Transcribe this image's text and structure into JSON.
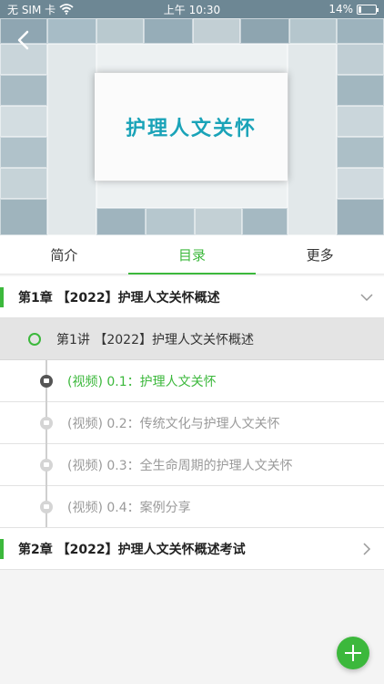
{
  "status_bar": {
    "carrier": "无 SIM 卡",
    "time": "上午 10:30",
    "battery": "14%",
    "battery_level": 0.14
  },
  "banner": {
    "title": "护理人文关怀"
  },
  "tabs": [
    {
      "label": "简介"
    },
    {
      "label": "目录"
    },
    {
      "label": "更多"
    }
  ],
  "chapters": [
    {
      "label": "第1章 【2022】护理人文关怀概述"
    },
    {
      "label": "第2章 【2022】护理人文关怀概述考试"
    }
  ],
  "lecture": {
    "label": "第1讲 【2022】护理人文关怀概述"
  },
  "items": [
    {
      "label": "(视频) 0.1：护理人文关怀"
    },
    {
      "label": "(视频) 0.2：传统文化与护理人文关怀"
    },
    {
      "label": "(视频) 0.3：全生命周期的护理人文关怀"
    },
    {
      "label": "(视频) 0.4：案例分享"
    }
  ],
  "colors": {
    "accent": "#3cb83c",
    "banner_title": "#1aa3b8"
  },
  "icons": [
    "back-icon",
    "wifi-icon",
    "battery-icon",
    "chevron-down-icon",
    "chevron-right-icon",
    "add-icon"
  ]
}
